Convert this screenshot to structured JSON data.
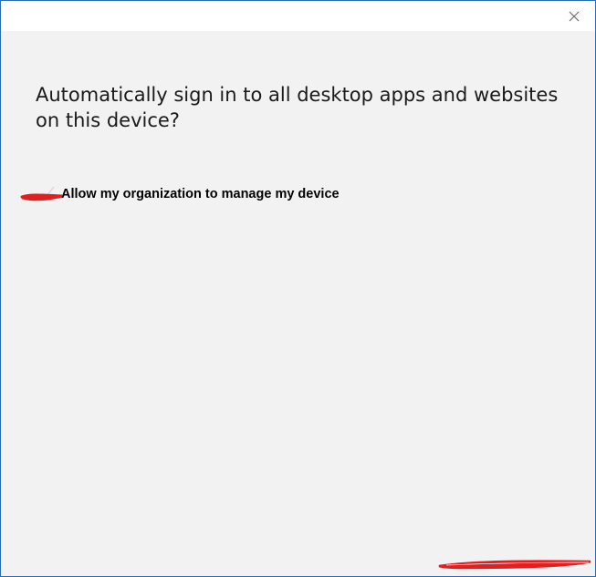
{
  "window": {
    "close_icon": "close-icon",
    "border_color": "#2b6cb0",
    "background": "#f2f2f2"
  },
  "dialog": {
    "headline": "Automatically sign in to all desktop apps and websites on this device?",
    "option_label": "Allow my organization to manage my device",
    "option_checked": true,
    "check_icon": "checkmark-icon"
  },
  "annotations": {
    "redaction_color": "#e02020"
  }
}
